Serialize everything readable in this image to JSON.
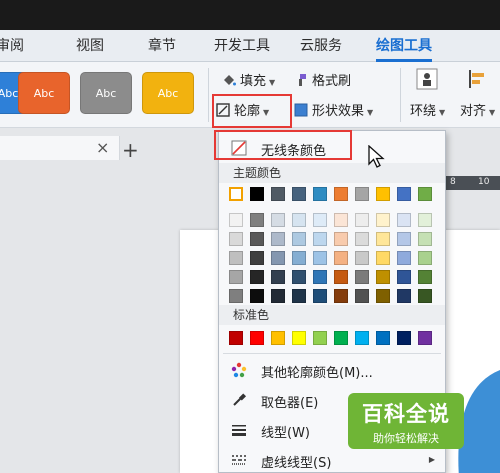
{
  "ribbon_tabs": [
    "审阅",
    "视图",
    "章节",
    "开发工具",
    "云服务",
    "绘图工具"
  ],
  "active_tab": "绘图工具",
  "style_buttons": [
    {
      "label": "Abc",
      "color": "#2e80d8"
    },
    {
      "label": "Abc",
      "color": "#e8642c"
    },
    {
      "label": "Abc",
      "color": "#8c8c8c"
    },
    {
      "label": "Abc",
      "color": "#f2b20f"
    }
  ],
  "ribbon": {
    "fill_label": "填充",
    "format_brush_label": "格式刷",
    "outline_label": "轮廓",
    "shape_effect_label": "形状效果",
    "wrap_label": "环绕",
    "align_label": "对齐"
  },
  "doc_tab": {
    "close_symbol": "×",
    "add_symbol": "+"
  },
  "ruler_labels": [
    "8",
    "10"
  ],
  "menu": {
    "no_line_label": "无线条颜色",
    "theme_colors_label": "主题颜色",
    "standard_colors_label": "标准色",
    "more_colors_label": "其他轮廓颜色(M)...",
    "eyedropper_label": "取色器(E)",
    "line_type_label": "线型(W)",
    "dash_type_label": "虚线线型(S)"
  },
  "theme_colors": {
    "base": [
      "#ffffff",
      "#000000",
      "#505a64",
      "#46627e",
      "#2e8cc2",
      "#ed7d31",
      "#a5a5a5",
      "#ffc000",
      "#4472c4",
      "#70ad47"
    ],
    "tints": [
      [
        "#f2f2f2",
        "#7f7f7f",
        "#d5dce4",
        "#d6e4f0",
        "#deebf7",
        "#fbe5d6",
        "#ededed",
        "#fff2cc",
        "#dae3f3",
        "#e2f0d9"
      ],
      [
        "#d9d9d9",
        "#595959",
        "#adb9ca",
        "#adc9e1",
        "#bdd7ee",
        "#f8cbad",
        "#dbdbdb",
        "#ffe699",
        "#b4c7e7",
        "#c5e0b4"
      ],
      [
        "#bfbfbf",
        "#3f3f3f",
        "#8497b0",
        "#85aed2",
        "#9dc3e6",
        "#f4b183",
        "#c9c9c9",
        "#ffd966",
        "#8faadc",
        "#a9d18e"
      ],
      [
        "#a6a6a6",
        "#262626",
        "#323f4f",
        "#2f4f6e",
        "#2e75b6",
        "#c55a11",
        "#7b7b7b",
        "#bf9000",
        "#2f5597",
        "#548235"
      ],
      [
        "#7f7f7f",
        "#0d0d0d",
        "#222a35",
        "#1f3449",
        "#1f4e79",
        "#843c0c",
        "#525252",
        "#7f6000",
        "#203864",
        "#385723"
      ]
    ]
  },
  "standard_colors": [
    "#c00000",
    "#ff0000",
    "#ffc000",
    "#ffff00",
    "#92d050",
    "#00b050",
    "#00b0f0",
    "#0070c0",
    "#002060",
    "#7030a0"
  ],
  "watermark": {
    "title": "百科全说",
    "subtitle": "助你轻松解决"
  }
}
